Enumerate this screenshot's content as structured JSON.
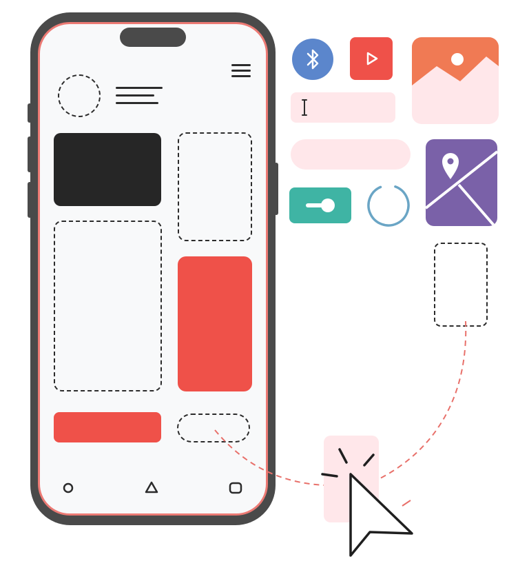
{
  "illustration": {
    "type": "mobile-ui-design-illustration"
  },
  "phone": {
    "nav_icons": [
      "home-circle-icon",
      "back-triangle-icon",
      "recents-square-icon"
    ],
    "menu_icon": "hamburger-menu-icon"
  },
  "widgets": {
    "bluetooth_icon": "bluetooth-icon",
    "play_icon": "play-icon",
    "image_icon": "image-placeholder-icon",
    "map_icon": "map-pin-icon",
    "text_cursor_icon": "text-cursor-icon"
  },
  "colors": {
    "phone_body": "#4a4a4a",
    "screen_border": "#ec7a74",
    "accent_red": "#ef5149",
    "pale_pink": "#ffe7ea",
    "bluetooth_blue": "#5b86cc",
    "toggle_teal": "#3fb4a4",
    "map_purple": "#7a61a8",
    "image_orange": "#f07a54",
    "spinner_blue": "#6aa5c5",
    "dashed_path": "#e8706a"
  },
  "cursor": {
    "icon": "mouse-pointer-icon",
    "click_effect": "click-burst-icon"
  }
}
